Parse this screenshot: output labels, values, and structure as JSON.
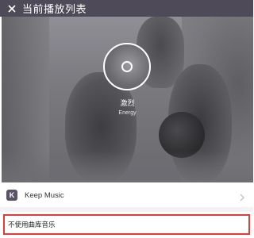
{
  "header": {
    "close_icon": "close-icon",
    "title": "当前播放列表"
  },
  "hero": {
    "playlist_name": "激烈",
    "playlist_subtitle": "Energy",
    "badge_icon": "play-ring-icon"
  },
  "sources": {
    "keep_music": {
      "logo_letter": "K",
      "label": "Keep Music",
      "chevron_icon": "chevron-right-icon"
    },
    "no_music": {
      "label": "不使用曲库音乐"
    }
  },
  "colors": {
    "header_bg": "#4f4a57",
    "highlight_border": "#e33a3a",
    "keep_logo_bg": "#5b5266"
  }
}
